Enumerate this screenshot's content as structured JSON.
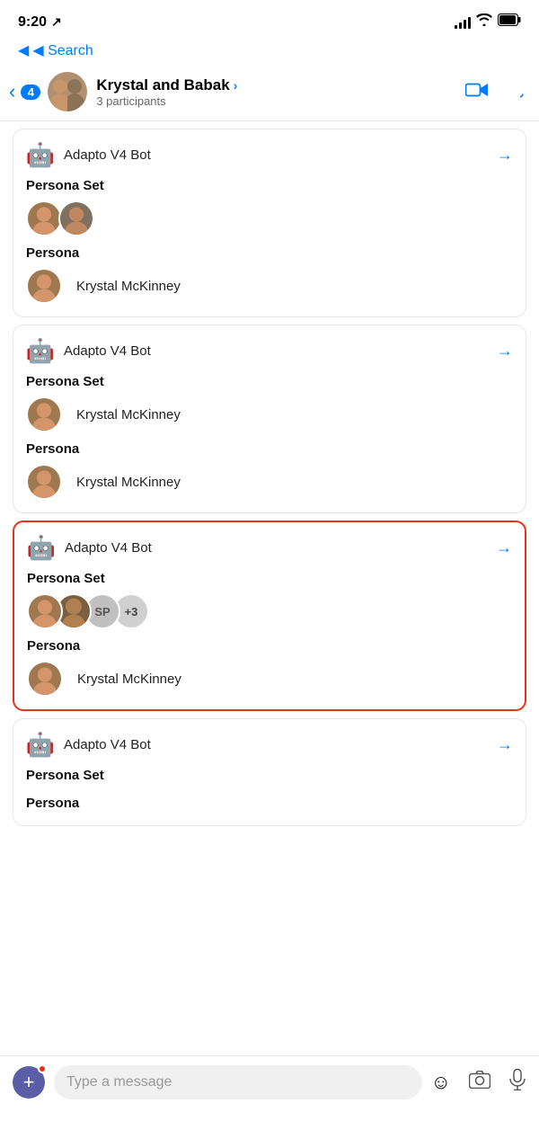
{
  "statusBar": {
    "time": "9:20",
    "locationIcon": "↗"
  },
  "header": {
    "backLabel": "◀ Search",
    "badge": "4",
    "chatTitle": "Krystal and Babak",
    "chevron": ">",
    "participants": "3 participants"
  },
  "messages": [
    {
      "id": "msg1",
      "sender": "Adapto V4 Bot",
      "highlighted": false,
      "sections": [
        {
          "label": "Persona Set",
          "type": "avatar-pair",
          "avatars": [
            "K1",
            "K2"
          ]
        },
        {
          "label": "Persona",
          "type": "single-persona",
          "name": "Krystal McKinney"
        }
      ]
    },
    {
      "id": "msg2",
      "sender": "Adapto V4 Bot",
      "highlighted": false,
      "sections": [
        {
          "label": "Persona Set",
          "type": "single-persona",
          "name": "Krystal McKinney"
        },
        {
          "label": "Persona",
          "type": "single-persona",
          "name": "Krystal McKinney"
        }
      ]
    },
    {
      "id": "msg3",
      "sender": "Adapto V4 Bot",
      "highlighted": true,
      "sections": [
        {
          "label": "Persona Set",
          "type": "avatar-group",
          "avatars": [
            "K",
            "M",
            "SP",
            "+3"
          ]
        },
        {
          "label": "Persona",
          "type": "single-persona",
          "name": "Krystal McKinney"
        }
      ]
    },
    {
      "id": "msg4",
      "sender": "Adapto V4 Bot",
      "highlighted": false,
      "sections": [
        {
          "label": "Persona Set",
          "type": "empty"
        },
        {
          "label": "Persona",
          "type": "empty"
        }
      ]
    }
  ],
  "inputBar": {
    "placeholder": "Type a message",
    "addIcon": "+",
    "emojiIcon": "☺",
    "cameraIcon": "📷",
    "micIcon": "🎙"
  }
}
